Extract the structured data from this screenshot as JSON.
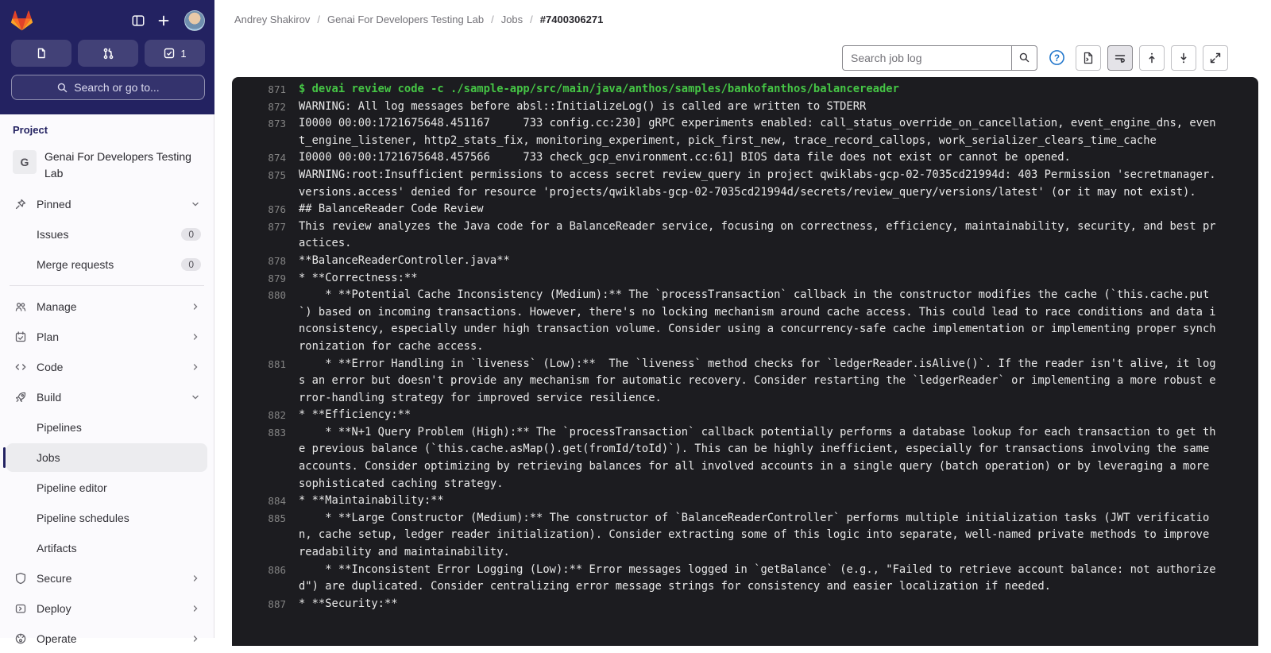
{
  "topbar": {
    "todo_count": "1",
    "search_label": "Search or go to..."
  },
  "breadcrumbs": {
    "items": [
      "Andrey Shakirov",
      "Genai For Developers Testing Lab",
      "Jobs"
    ],
    "current": "#7400306271",
    "separator": "/"
  },
  "sidebar": {
    "section_label": "Project",
    "project": {
      "initial": "G",
      "name": "Genai For Developers Testing Lab"
    },
    "items": [
      {
        "label": "Pinned"
      },
      {
        "label": "Issues",
        "badge": "0"
      },
      {
        "label": "Merge requests",
        "badge": "0"
      },
      {
        "label": "Manage"
      },
      {
        "label": "Plan"
      },
      {
        "label": "Code"
      },
      {
        "label": "Build"
      },
      {
        "label": "Pipelines"
      },
      {
        "label": "Jobs"
      },
      {
        "label": "Pipeline editor"
      },
      {
        "label": "Pipeline schedules"
      },
      {
        "label": "Artifacts"
      },
      {
        "label": "Secure"
      },
      {
        "label": "Deploy"
      },
      {
        "label": "Operate"
      }
    ]
  },
  "job_log": {
    "search_placeholder": "Search job log",
    "toolbar_icons": [
      "help",
      "show-raw-log",
      "wrap-lines",
      "scroll-to-top",
      "scroll-to-bottom",
      "fullscreen"
    ],
    "colors": {
      "command_green": "#45c545",
      "background": "#1c1c20",
      "line_number": "#848484"
    },
    "lines": [
      {
        "n": "871",
        "t": "$ devai review code -c ./sample-app/src/main/java/anthos/samples/bankofanthos/balancereader"
      },
      {
        "n": "872",
        "t": "WARNING: All log messages before absl::InitializeLog() is called are written to STDERR"
      },
      {
        "n": "873",
        "t": "I0000 00:00:1721675648.451167     733 config.cc:230] gRPC experiments enabled: call_status_override_on_cancellation, event_engine_dns, event_engine_listener, http2_stats_fix, monitoring_experiment, pick_first_new, trace_record_callops, work_serializer_clears_time_cache"
      },
      {
        "n": "874",
        "t": "I0000 00:00:1721675648.457566     733 check_gcp_environment.cc:61] BIOS data file does not exist or cannot be opened."
      },
      {
        "n": "875",
        "t": "WARNING:root:Insufficient permissions to access secret review_query in project qwiklabs-gcp-02-7035cd21994d: 403 Permission 'secretmanager.versions.access' denied for resource 'projects/qwiklabs-gcp-02-7035cd21994d/secrets/review_query/versions/latest' (or it may not exist)."
      },
      {
        "n": "876",
        "t": "## BalanceReader Code Review"
      },
      {
        "n": "877",
        "t": "This review analyzes the Java code for a BalanceReader service, focusing on correctness, efficiency, maintainability, security, and best practices."
      },
      {
        "n": "878",
        "t": "**BalanceReaderController.java**"
      },
      {
        "n": "879",
        "t": "* **Correctness:**"
      },
      {
        "n": "880",
        "t": "    * **Potential Cache Inconsistency (Medium):** The `processTransaction` callback in the constructor modifies the cache (`this.cache.put`) based on incoming transactions. However, there's no locking mechanism around cache access. This could lead to race conditions and data inconsistency, especially under high transaction volume. Consider using a concurrency-safe cache implementation or implementing proper synchronization for cache access."
      },
      {
        "n": "881",
        "t": "    * **Error Handling in `liveness` (Low):**  The `liveness` method checks for `ledgerReader.isAlive()`. If the reader isn't alive, it logs an error but doesn't provide any mechanism for automatic recovery. Consider restarting the `ledgerReader` or implementing a more robust error-handling strategy for improved service resilience."
      },
      {
        "n": "882",
        "t": "* **Efficiency:**"
      },
      {
        "n": "883",
        "t": "    * **N+1 Query Problem (High):** The `processTransaction` callback potentially performs a database lookup for each transaction to get the previous balance (`this.cache.asMap().get(fromId/toId)`). This can be highly inefficient, especially for transactions involving the same accounts. Consider optimizing by retrieving balances for all involved accounts in a single query (batch operation) or by leveraging a more sophisticated caching strategy."
      },
      {
        "n": "884",
        "t": "* **Maintainability:**"
      },
      {
        "n": "885",
        "t": "    * **Large Constructor (Medium):** The constructor of `BalanceReaderController` performs multiple initialization tasks (JWT verification, cache setup, ledger reader initialization). Consider extracting some of this logic into separate, well-named private methods to improve readability and maintainability."
      },
      {
        "n": "886",
        "t": "    * **Inconsistent Error Logging (Low):** Error messages logged in `getBalance` (e.g., \"Failed to retrieve account balance: not authorized\") are duplicated. Consider centralizing error message strings for consistency and easier localization if needed."
      },
      {
        "n": "887",
        "t": "* **Security:**"
      }
    ]
  }
}
